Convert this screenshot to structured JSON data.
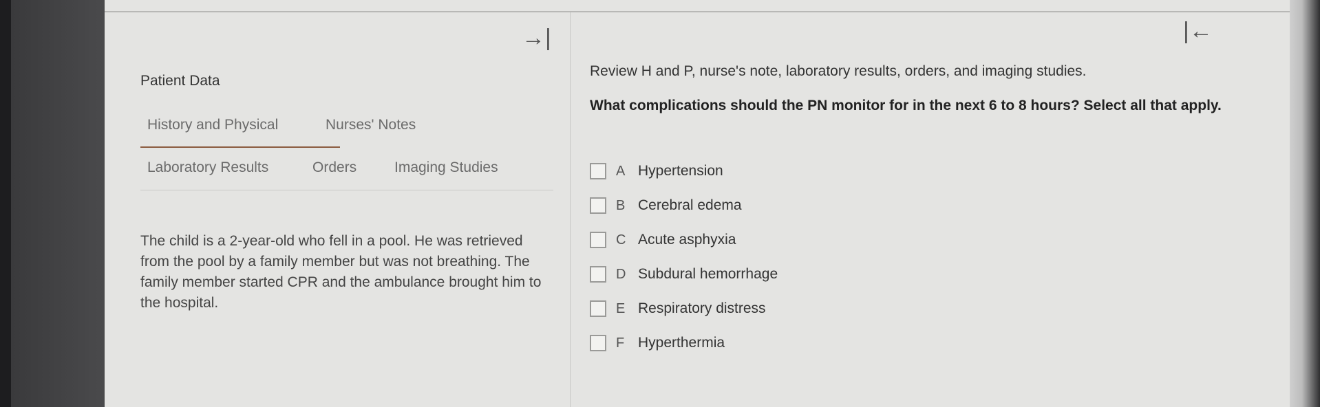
{
  "left_panel": {
    "collapse_icon": "arrow-right-to-bar-icon",
    "title": "Patient Data",
    "tabs": [
      {
        "label": "History and Physical",
        "active": true
      },
      {
        "label": "Nurses' Notes",
        "active": false
      },
      {
        "label": "Laboratory Results",
        "active": false
      },
      {
        "label": "Orders",
        "active": false
      },
      {
        "label": "Imaging Studies",
        "active": false
      }
    ],
    "content": "The child is a 2-year-old who fell in a pool. He was retrieved from the pool by a family member but was not breathing. The family member started CPR and the ambulance brought him to the hospital."
  },
  "right_panel": {
    "collapse_icon": "arrow-left-to-bar-icon",
    "instruction": "Review H and P, nurse's note, laboratory results, orders, and imaging studies.",
    "question": "What complications should the PN monitor for in the next 6 to 8 hours? Select all that apply.",
    "options": [
      {
        "letter": "A",
        "text": "Hypertension",
        "checked": false
      },
      {
        "letter": "B",
        "text": "Cerebral edema",
        "checked": false
      },
      {
        "letter": "C",
        "text": "Acute asphyxia",
        "checked": false
      },
      {
        "letter": "D",
        "text": "Subdural hemorrhage",
        "checked": false
      },
      {
        "letter": "E",
        "text": "Respiratory distress",
        "checked": false
      },
      {
        "letter": "F",
        "text": "Hyperthermia",
        "checked": false
      }
    ]
  },
  "colors": {
    "active_tab_underline": "#8b5b3f",
    "panel_background": "#e4e4e2"
  }
}
